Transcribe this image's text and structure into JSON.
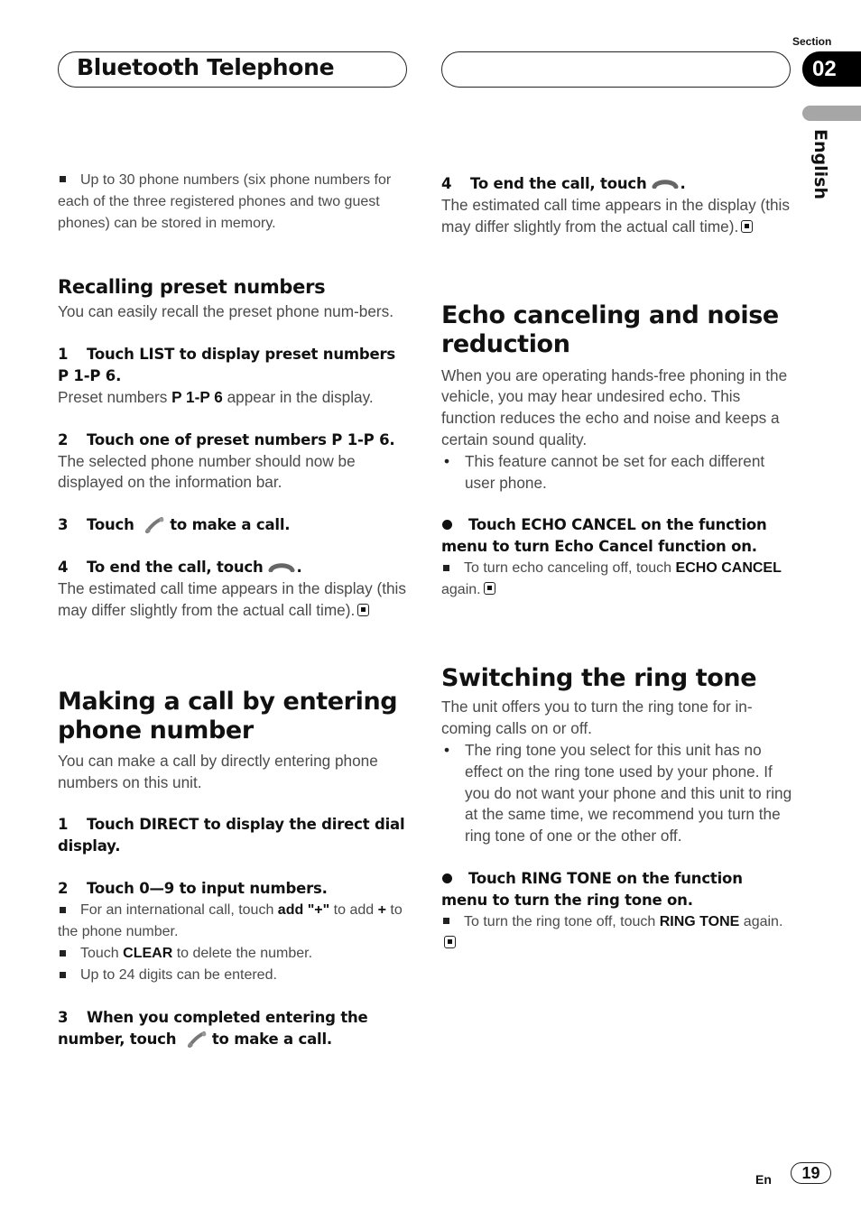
{
  "header": {
    "title": "Bluetooth Telephone",
    "section_label": "Section",
    "section_number": "02",
    "language": "English"
  },
  "left": {
    "intro_note": "Up to 30 phone numbers (six phone numbers for each of the three registered phones and two guest phones) can be stored in memory.",
    "recalling": {
      "heading": "Recalling preset numbers",
      "intro": "You can easily recall the preset phone num-bers.",
      "step1_num": "1",
      "step1": "Touch LIST to display preset numbers P 1-P 6.",
      "step1_body_pre": "Preset numbers ",
      "step1_body_bold": "P 1-P 6",
      "step1_body_post": " appear in the display.",
      "step2_num": "2",
      "step2": "Touch one of preset numbers P 1-P 6.",
      "step2_body": "The selected phone number should now be displayed on the information bar.",
      "step3_num": "3",
      "step3_pre": "Touch",
      "step3_post": "to make a call.",
      "step4_num": "4",
      "step4_pre": "To end the call, touch",
      "step4_post": ".",
      "step4_body": "The estimated call time appears in the display (this may differ slightly from the actual call time)."
    },
    "making": {
      "heading": "Making a call by entering phone number",
      "intro": "You can make a call by directly entering phone numbers on this unit.",
      "step1_num": "1",
      "step1": "Touch DIRECT to display the direct dial display.",
      "step2_num": "2",
      "step2": "Touch 0—9 to input numbers.",
      "note1_pre": "For an international call, touch ",
      "note1_bold": "add \"+\"",
      "note1_mid": " to add ",
      "note1_bold2": "+",
      "note1_post": " to the phone number.",
      "note2_pre": "Touch ",
      "note2_bold": "CLEAR",
      "note2_post": " to delete the number.",
      "note3": "Up to 24 digits can be entered.",
      "step3_num": "3",
      "step3_pre": "When you completed entering the number, touch",
      "step3_post": "to make a call."
    }
  },
  "right": {
    "cont": {
      "step4_num": "4",
      "step4_pre": "To end the call, touch",
      "step4_post": ".",
      "step4_body": "The estimated call time appears in the display (this may differ slightly from the actual call time)."
    },
    "echo": {
      "heading": "Echo canceling and noise reduction",
      "intro": "When you are operating hands-free phoning in the vehicle, you may hear undesired echo. This function reduces the echo and noise and keeps a certain sound quality.",
      "bullet": "This feature cannot be set for each different user phone.",
      "step": "Touch ECHO CANCEL on the function menu to turn Echo Cancel function on.",
      "note_pre": "To turn echo canceling off, touch ",
      "note_bold": "ECHO CANCEL",
      "note_post": " again."
    },
    "ring": {
      "heading": "Switching the ring tone",
      "intro": "The unit offers you to turn the ring tone for in-coming calls on or off.",
      "bullet": "The ring tone you select for this unit has no effect on the ring tone used by your phone. If you do not want your phone and this unit to ring at the same time, we recommend you turn the ring tone of one or the other off.",
      "step": "Touch RING TONE on the function menu to turn the ring tone on.",
      "note_pre": "To turn the ring tone off, touch ",
      "note_bold": "RING TONE",
      "note_post": " again."
    }
  },
  "footer": {
    "lang_code": "En",
    "page_number": "19"
  }
}
